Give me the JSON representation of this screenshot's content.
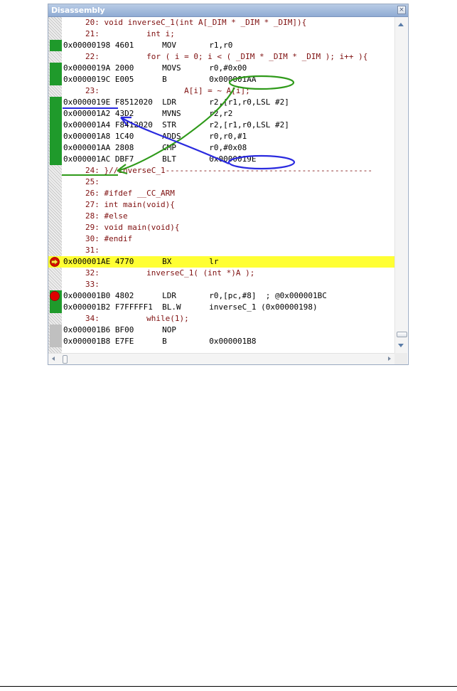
{
  "window": {
    "title": "Disassembly",
    "close_symbol": "×"
  },
  "colors": {
    "source": "#7f1010",
    "asm": "#000000",
    "coverage": "#1f9a2b",
    "highlight": "#ffff33",
    "annot_green": "#2f9a1a",
    "annot_blue": "#2a2adf"
  },
  "lines": [
    {
      "kind": "src",
      "text": "20: void inverseC_1(int A[_DIM * _DIM * _DIM]){",
      "coverage": "gray"
    },
    {
      "kind": "src",
      "text": "21:          int i;",
      "coverage": "gray"
    },
    {
      "kind": "asm",
      "text": "0x00000198 4601      MOV       r1,r0",
      "coverage": "green"
    },
    {
      "kind": "src",
      "text": "22:          for ( i = 0; i < ( _DIM * _DIM * _DIM ); i++ ){",
      "coverage": "gray"
    },
    {
      "kind": "asm",
      "text": "0x0000019A 2000      MOVS      r0,#0x00",
      "coverage": "green"
    },
    {
      "kind": "asm",
      "text": "0x0000019C E005      B         0x000001AA",
      "coverage": "green"
    },
    {
      "kind": "src",
      "text": "23:                  A[i] = ~ A[i];",
      "coverage": "gray"
    },
    {
      "kind": "asm",
      "text": "0x0000019E F8512020  LDR       r2,[r1,r0,LSL #2]",
      "coverage": "green"
    },
    {
      "kind": "asm",
      "text": "0x000001A2 43D2      MVNS      r2,r2",
      "coverage": "green"
    },
    {
      "kind": "asm",
      "text": "0x000001A4 F8412020  STR       r2,[r1,r0,LSL #2]",
      "coverage": "green"
    },
    {
      "kind": "asm",
      "text": "0x000001A8 1C40      ADDS      r0,r0,#1",
      "coverage": "green"
    },
    {
      "kind": "asm",
      "text": "0x000001AA 2808      CMP       r0,#0x08",
      "coverage": "green"
    },
    {
      "kind": "asm",
      "text": "0x000001AC DBF7      BLT       0x0000019E",
      "coverage": "green"
    },
    {
      "kind": "src",
      "text": "24: }//inverseC_1--------------------------------------------",
      "coverage": "gray"
    },
    {
      "kind": "src",
      "text": "25:",
      "coverage": "gray"
    },
    {
      "kind": "src",
      "text": "26: #ifdef __CC_ARM",
      "coverage": "gray"
    },
    {
      "kind": "src",
      "text": "27: int main(void){",
      "coverage": "gray"
    },
    {
      "kind": "src",
      "text": "28: #else",
      "coverage": "gray"
    },
    {
      "kind": "src",
      "text": "29: void main(void){",
      "coverage": "gray"
    },
    {
      "kind": "src",
      "text": "30: #endif",
      "coverage": "gray"
    },
    {
      "kind": "src",
      "text": "31:",
      "coverage": "gray"
    },
    {
      "kind": "asm",
      "text": "0x000001AE 4770      BX        lr",
      "coverage": "none",
      "highlight": true,
      "marker": "current-pc"
    },
    {
      "kind": "src",
      "text": "32:          inverseC_1( (int *)A );",
      "coverage": "gray"
    },
    {
      "kind": "src",
      "text": "33:",
      "coverage": "gray"
    },
    {
      "kind": "asm",
      "text": "0x000001B0 4802      LDR       r0,[pc,#8]  ; @0x000001BC",
      "coverage": "green",
      "marker": "breakpoint"
    },
    {
      "kind": "asm",
      "text": "0x000001B2 F7FFFFF1  BL.W      inverseC_1 (0x00000198)",
      "coverage": "green"
    },
    {
      "kind": "src",
      "text": "34:          while(1);",
      "coverage": "gray"
    },
    {
      "kind": "asm",
      "text": "0x000001B6 BF00      NOP",
      "coverage": "solidgray"
    },
    {
      "kind": "asm",
      "text": "0x000001B8 E7FE      B         0x000001B8",
      "coverage": "solidgray"
    }
  ],
  "icons": {
    "current_pc": "current-line-arrow-icon",
    "breakpoint": "breakpoint-icon"
  }
}
